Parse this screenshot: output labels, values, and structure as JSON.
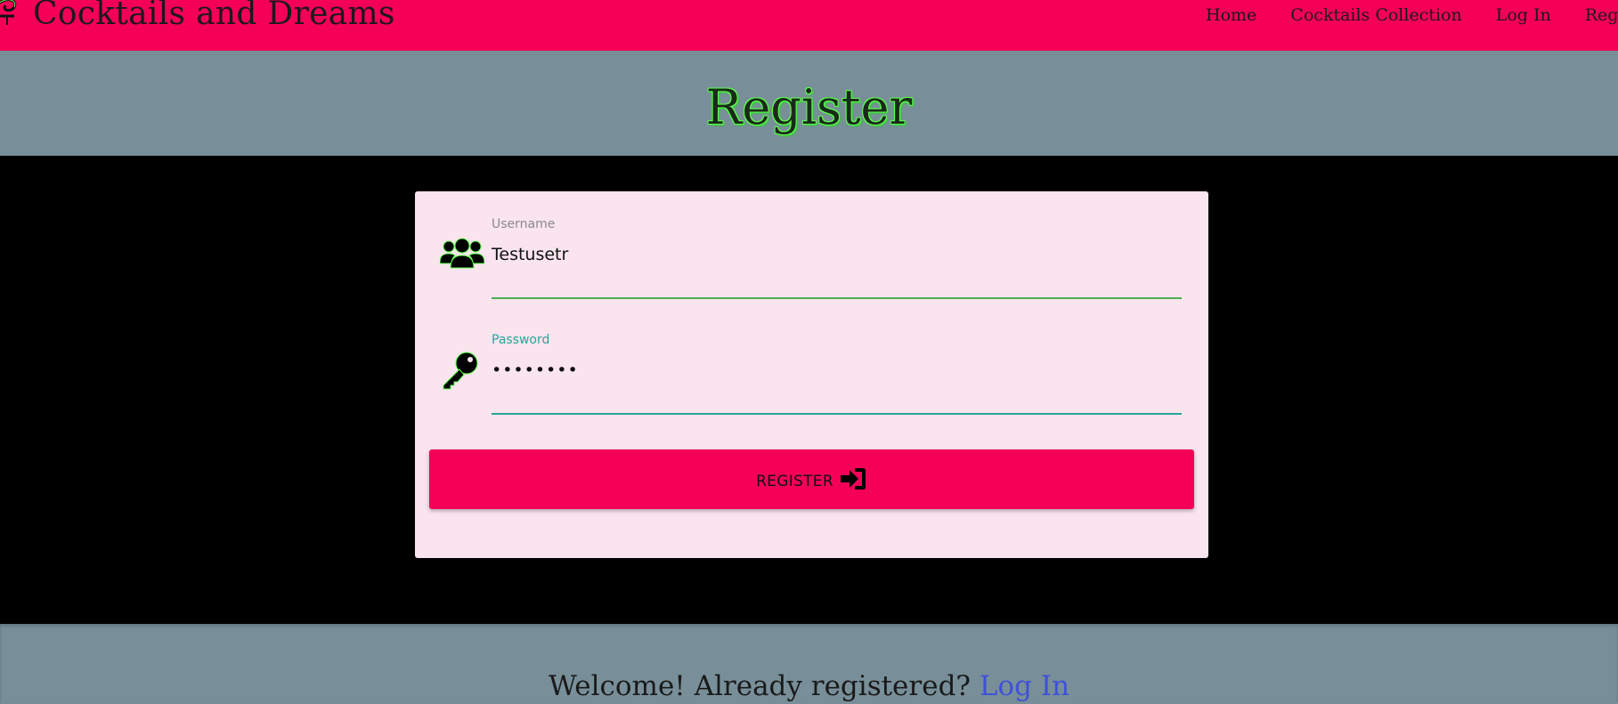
{
  "brand": {
    "title": "Cocktails and Dreams",
    "icon": "cocktail-logo-icon"
  },
  "nav": {
    "items": [
      {
        "label": "Home"
      },
      {
        "label": "Cocktails Collection"
      },
      {
        "label": "Log In"
      },
      {
        "label": "Register"
      }
    ]
  },
  "page": {
    "title": "Register"
  },
  "form": {
    "username": {
      "label": "Username",
      "value": "Testusetr",
      "icon": "users-icon"
    },
    "password": {
      "label": "Password",
      "value": "••••••••",
      "icon": "key-icon"
    },
    "submit": {
      "label": "REGISTER",
      "icon": "sign-in-icon"
    }
  },
  "footer": {
    "prompt": "Welcome! Already registered? ",
    "link_label": "Log In"
  },
  "colors": {
    "navbar": "#f50057",
    "band": "#788f99",
    "card": "#fae4ee",
    "username_underline": "#4caf50",
    "password_underline": "#26a69a",
    "password_label": "#26a69a",
    "link": "#3f51d6"
  }
}
